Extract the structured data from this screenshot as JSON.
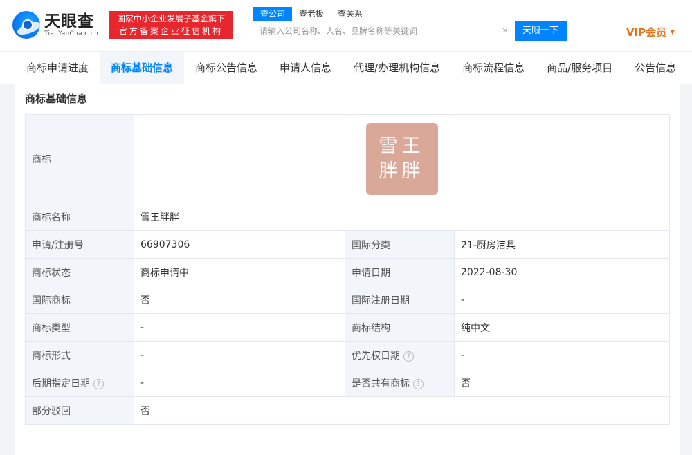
{
  "header": {
    "logo_cn": "天眼查",
    "logo_en": "TianYanCha.com",
    "badge_line1": "国家中小企业发展子基金旗下",
    "badge_line2": "官方备案企业征信机构",
    "search_tabs": [
      "查公司",
      "查老板",
      "查关系"
    ],
    "search_placeholder": "请输入公司名称、人名、品牌名称等关键词",
    "clear_icon": "✕",
    "search_button": "天眼一下",
    "vip_label": "VIP会员"
  },
  "nav": {
    "items": [
      "商标申请进度",
      "商标基础信息",
      "商标公告信息",
      "申请人信息",
      "代理/办理机构信息",
      "商标流程信息",
      "商品/服务项目",
      "公告信息"
    ],
    "active_index": 1
  },
  "section": {
    "title": "商标基础信息"
  },
  "trademark": {
    "label": "商标",
    "image_line1": "雪王",
    "image_line2": "胖胖",
    "image_color": "#d9a898",
    "name_label": "商标名称",
    "name_value": "雪王胖胖",
    "reg_no_label": "申请/注册号",
    "reg_no_value": "66907306",
    "intl_class_label": "国际分类",
    "intl_class_value": "21-厨房洁具",
    "status_label": "商标状态",
    "status_value": "商标申请中",
    "apply_date_label": "申请日期",
    "apply_date_value": "2022-08-30",
    "intl_mark_label": "国际商标",
    "intl_mark_value": "否",
    "intl_reg_date_label": "国际注册日期",
    "intl_reg_date_value": "-",
    "type_label": "商标类型",
    "type_value": "-",
    "structure_label": "商标结构",
    "structure_value": "纯中文",
    "form_label": "商标形式",
    "form_value": "-",
    "priority_date_label": "优先权日期",
    "priority_date_value": "-",
    "later_date_label": "后期指定日期",
    "later_date_value": "-",
    "shared_label": "是否共有商标",
    "shared_value": "否",
    "partial_reject_label": "部分驳回",
    "partial_reject_value": "否"
  },
  "colors": {
    "accent": "#0084ff",
    "badge": "#e8262e",
    "vip": "#e8741c"
  }
}
